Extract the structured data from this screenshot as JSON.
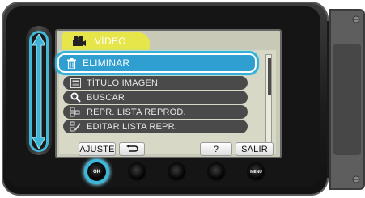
{
  "screen": {
    "tab_label": "VÍDEO",
    "menu_items": [
      {
        "label": "ELIMINAR",
        "icon": "trash-icon",
        "selected": true
      },
      {
        "label": "TÍTULO IMAGEN",
        "icon": "title-image-icon",
        "selected": false
      },
      {
        "label": "BUSCAR",
        "icon": "magnifier-icon",
        "selected": false
      },
      {
        "label": "REPR. LISTA REPROD.",
        "icon": "playlist-play-icon",
        "selected": false
      },
      {
        "label": "EDITAR LISTA REPR.",
        "icon": "playlist-edit-icon",
        "selected": false
      }
    ]
  },
  "softkeys": {
    "ajuste": "AJUSTE",
    "back_icon": "return-arrow-icon",
    "help": "?",
    "salir": "SALIR"
  },
  "hardware": {
    "ok": "OK",
    "menu": "MENU"
  },
  "colors": {
    "highlight": "#35b0d8",
    "tab": "#e6e64a",
    "item_bg": "#4a4a4a",
    "selected_bg": "#2f9ed0"
  }
}
